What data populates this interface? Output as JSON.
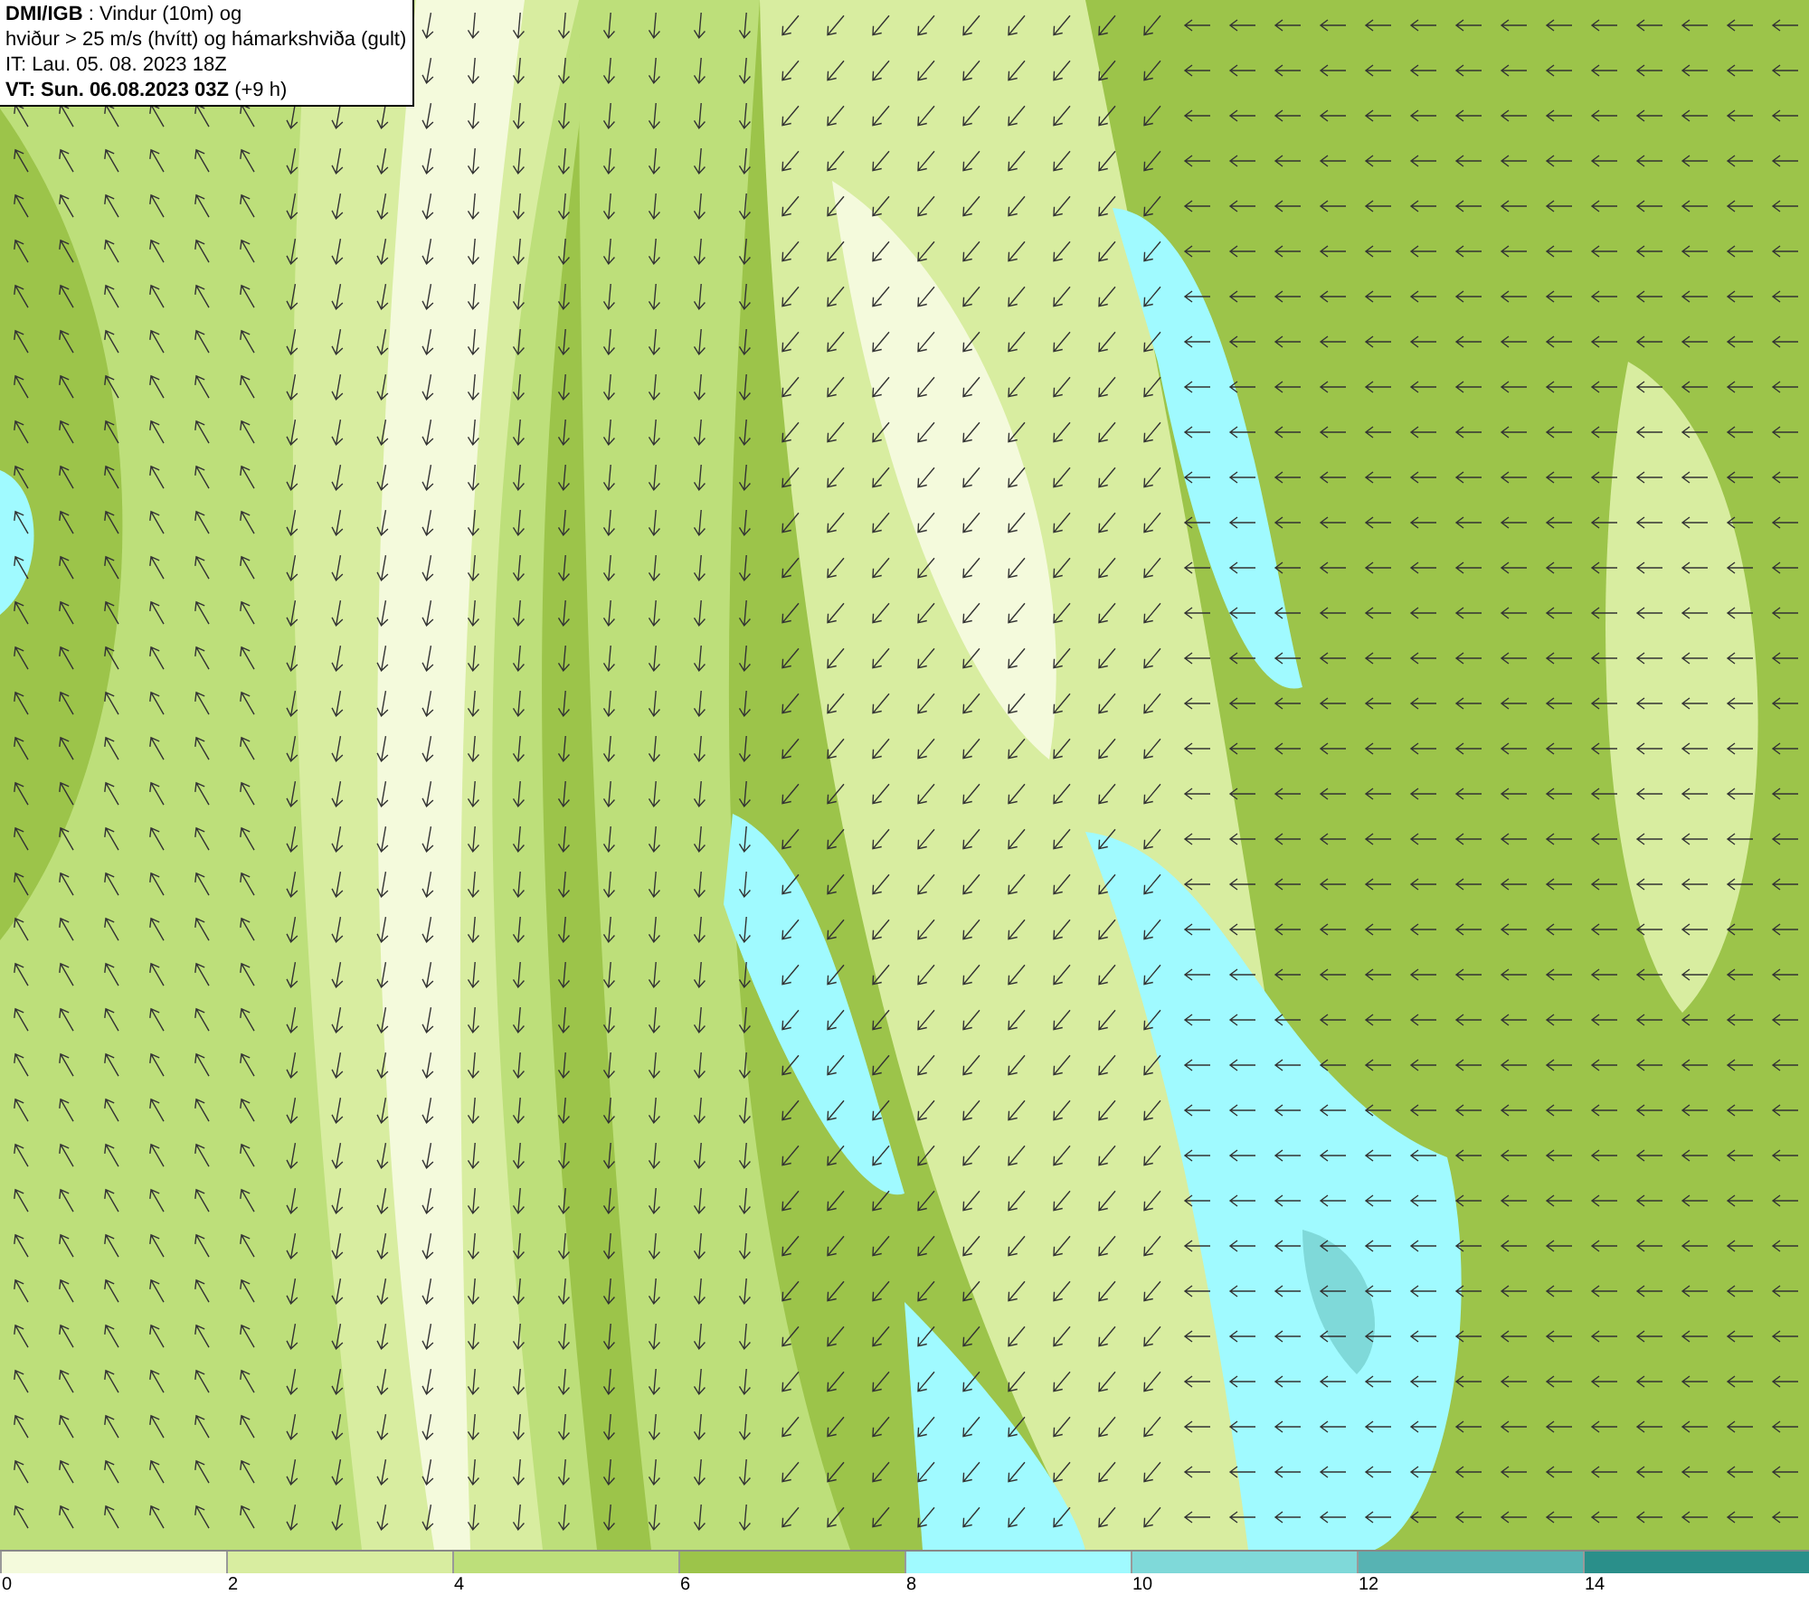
{
  "info_box": {
    "lines": [
      "**DMI/IGB** : Vindur (10m) og",
      "hviður > 25 m/s (hvítt) og hámarkshviða (gult)",
      "IT: Lau. 05. 08. 2023 18Z",
      "**VT: Sun. 06.08.2023 03Z** (+9 h)"
    ]
  },
  "legend": {
    "bins": [
      {
        "color": "#f4fadc",
        "label": "0"
      },
      {
        "color": "#d8eda0",
        "label": "2"
      },
      {
        "color": "#bddf7a",
        "label": "4"
      },
      {
        "color": "#9cc44a",
        "label": "6"
      },
      {
        "color": "#a0faff",
        "label": "8"
      },
      {
        "color": "#7fd9d9",
        "label": "10"
      },
      {
        "color": "#57b3b3",
        "label": "12"
      },
      {
        "color": "#2a8f8a",
        "label": "14"
      }
    ]
  }
}
